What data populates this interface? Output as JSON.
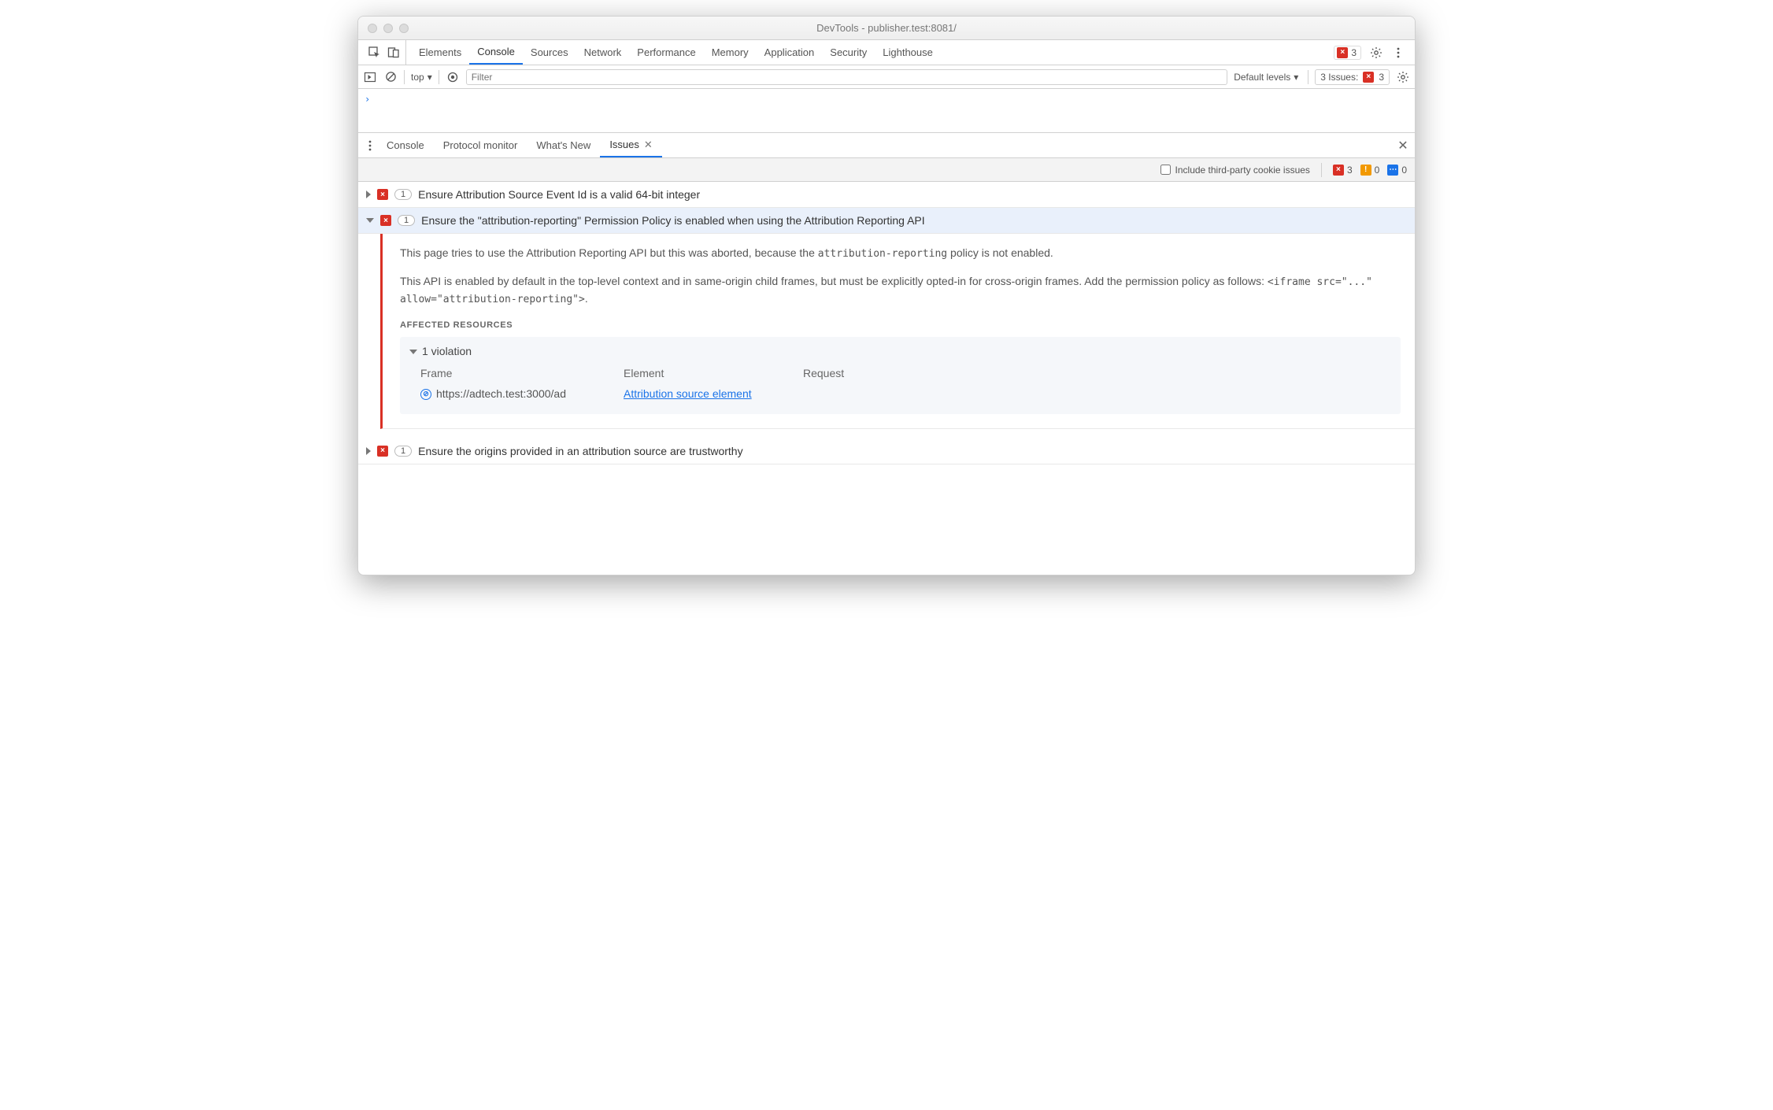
{
  "window": {
    "title": "DevTools - publisher.test:8081/"
  },
  "tabs": {
    "main": [
      "Elements",
      "Console",
      "Sources",
      "Network",
      "Performance",
      "Memory",
      "Application",
      "Security",
      "Lighthouse"
    ],
    "active": "Console",
    "error_count": "3"
  },
  "console_toolbar": {
    "context": "top",
    "filter_placeholder": "Filter",
    "levels": "Default levels",
    "issues_label": "3 Issues:",
    "issues_count": "3"
  },
  "console_prompt": "›",
  "drawer": {
    "tabs": [
      "Console",
      "Protocol monitor",
      "What's New",
      "Issues"
    ],
    "active": "Issues"
  },
  "issues_header": {
    "checkbox_label": "Include third-party cookie issues",
    "err": "3",
    "warn": "0",
    "info": "0"
  },
  "issues": [
    {
      "count": "1",
      "title": "Ensure Attribution Source Event Id is a valid 64-bit integer",
      "expanded": false
    },
    {
      "count": "1",
      "title": "Ensure the \"attribution-reporting\" Permission Policy is enabled when using the Attribution Reporting API",
      "expanded": true
    },
    {
      "count": "1",
      "title": "Ensure the origins provided in an attribution source are trustworthy",
      "expanded": false
    }
  ],
  "detail": {
    "p1a": "This page tries to use the Attribution Reporting API but this was aborted, because the ",
    "p1code": "attribution-reporting",
    "p1b": " policy is not enabled.",
    "p2a": "This API is enabled by default in the top-level context and in same-origin child frames, but must be explicitly opted-in for cross-origin frames. Add the permission policy as follows: ",
    "p2code": "<iframe src=\"...\" allow=\"attribution-reporting\">",
    "p2b": ".",
    "section": "AFFECTED RESOURCES",
    "violation_label": "1 violation",
    "th_frame": "Frame",
    "th_element": "Element",
    "th_request": "Request",
    "frame_url": "https://adtech.test:3000/ad",
    "element_link": "Attribution source element"
  }
}
